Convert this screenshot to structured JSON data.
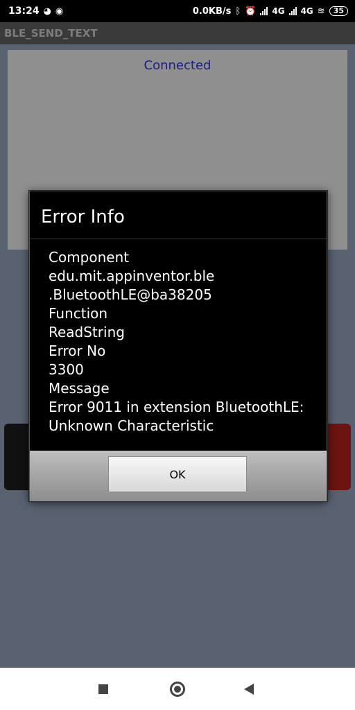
{
  "status_bar": {
    "time": "13:24",
    "net_speed": "0.0KB/s",
    "network1": "4G",
    "network2": "4G",
    "battery": "35",
    "icons": [
      "notification-icon",
      "record-icon",
      "bluetooth-icon",
      "alarm-icon",
      "signal-icon",
      "wifi-icon",
      "battery-icon"
    ]
  },
  "app": {
    "title": "BLE_SEND_TEXT",
    "status_label": "Connected"
  },
  "dialog": {
    "title": "Error Info",
    "lines": [
      "Component",
      "edu.mit.appinventor.ble",
      ".BluetoothLE@ba38205",
      "Function",
      "ReadString",
      "Error No",
      "3300",
      "Message",
      "Error 9011 in extension BluetoothLE:",
      "Unknown Characteristic"
    ],
    "ok_label": "OK"
  },
  "nav_bar": {
    "icons": [
      "recents-square-icon",
      "home-circle-icon",
      "back-triangle-icon"
    ]
  }
}
